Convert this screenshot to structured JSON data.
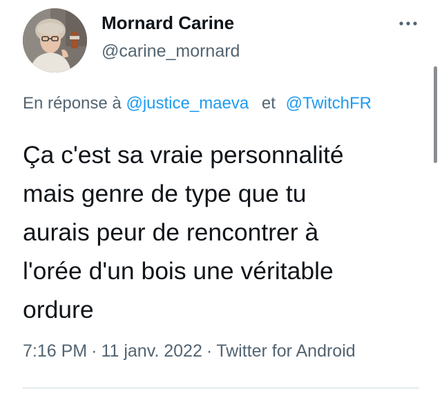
{
  "author": {
    "name": "Mornard Carine",
    "handle": "@carine_mornard",
    "avatar_icon": "profile-photo"
  },
  "menu": {
    "more_icon": "more-horizontal-icon"
  },
  "reply": {
    "prefix": "En réponse à",
    "mention_1": "@justice_maeva",
    "conjunction": "et",
    "mention_2": "@TwitchFR"
  },
  "tweet": {
    "lines": [
      "Ça c'est sa vraie personnalité",
      "mais genre de type que tu",
      "aurais peur de rencontrer à",
      "l'orée d'un bois une véritable",
      "ordure"
    ]
  },
  "meta": {
    "time": "7:16 PM",
    "separator": "·",
    "date": "11 janv. 2022",
    "source": "Twitter for Android"
  },
  "colors": {
    "text": "#0f1419",
    "secondary": "#536471",
    "link": "#1d9bf0",
    "divider": "#cfd9de"
  }
}
